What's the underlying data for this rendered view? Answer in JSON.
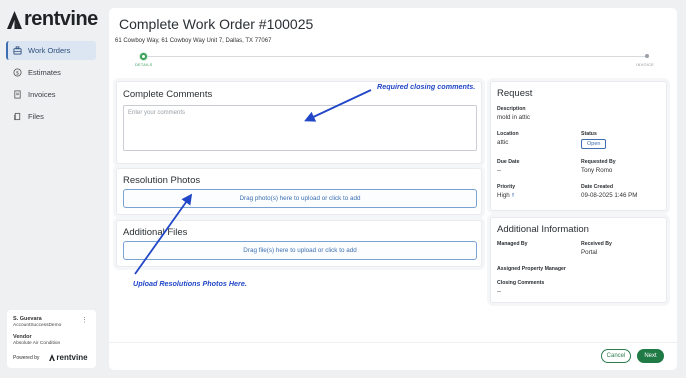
{
  "brand": {
    "name": "rentvine",
    "accent": "#3d6fb0",
    "green": "#1f7a45"
  },
  "sidebar": {
    "items": [
      {
        "label": "Work Orders",
        "icon": "toolbox-icon",
        "active": true
      },
      {
        "label": "Estimates",
        "icon": "dollar-circle-icon",
        "active": false
      },
      {
        "label": "Invoices",
        "icon": "receipt-icon",
        "active": false
      },
      {
        "label": "Files",
        "icon": "file-stack-icon",
        "active": false
      }
    ],
    "user": {
      "name": "S. Guevara",
      "account": "AccountSuccessDemo",
      "role": "Vendor",
      "company": "Absolute Air Condition",
      "powered_by": "Powered by",
      "powered_brand": "rentvine"
    }
  },
  "page": {
    "title": "Complete Work Order #100025",
    "address": "61 Cowboy Way, 61 Cowboy Way Unit 7, Dallas, TX 77067"
  },
  "stepper": {
    "steps": [
      {
        "label": "DETAILS",
        "done": true
      },
      {
        "label": "INVOICE",
        "done": false
      }
    ]
  },
  "comments": {
    "title": "Complete Comments",
    "placeholder": "Enter your comments",
    "value": ""
  },
  "photos": {
    "title": "Resolution Photos",
    "dropzone": "Drag photo(s) here to upload or click to add"
  },
  "files": {
    "title": "Additional Files",
    "dropzone": "Drag file(s) here to upload or click to add"
  },
  "request": {
    "title": "Request",
    "description_label": "Description",
    "description": "mold in attic",
    "location_label": "Location",
    "location": "attic",
    "status_label": "Status",
    "status": "Open",
    "due_label": "Due Date",
    "due": "--",
    "requested_label": "Requested By",
    "requested": "Tony Romo",
    "priority_label": "Priority",
    "priority": "High",
    "created_label": "Date Created",
    "created": "09-08-2025 1:46 PM"
  },
  "additional": {
    "title": "Additional Information",
    "managed_label": "Managed By",
    "received_label": "Received By",
    "received": "Portal",
    "assigned_label": "Assigned Property Manager",
    "closing_label": "Closing Comments",
    "closing": "--"
  },
  "annotations": {
    "comments": "Required closing comments.",
    "photos": "Upload Resolutions Photos Here."
  },
  "footer": {
    "cancel": "Cancel",
    "next": "Next"
  }
}
